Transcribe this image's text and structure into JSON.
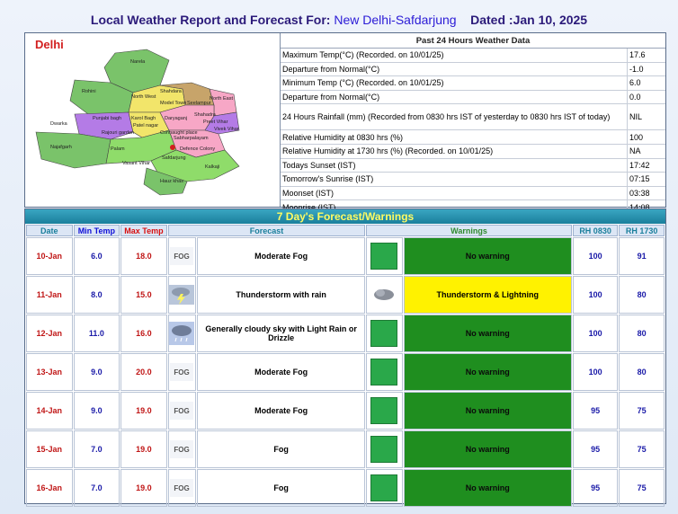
{
  "header": {
    "prefix": "Local Weather Report and Forecast For:",
    "station": "New Delhi-Safdarjung",
    "dated": "Dated :Jan 10, 2025"
  },
  "map": {
    "title": "Delhi",
    "labels": [
      "Narela",
      "Rohini",
      "North West",
      "Shahdara",
      "North East",
      "Model Town",
      "Seelampur",
      "Punjabi bagh",
      "Karol Bagh",
      "Daryaganj",
      "Dwarka",
      "Patel nagar",
      "Shahadra",
      "Preet Vihar",
      "Rajouri garden",
      "Connaught place",
      "Vivek Vihar",
      "Najafgarh",
      "Palam",
      "Sabharpalayam",
      "Defence Colony",
      "Safdarjung",
      "Vasant Vihar",
      "Kalkaji",
      "Hauz khas"
    ],
    "colors": {
      "outer": "#7ac36a",
      "west": "#b47be6",
      "central": "#f2e56a",
      "east": "#f7a7c6",
      "south": "#8fdc6a",
      "north": "#c7a46a"
    }
  },
  "past24": {
    "title": "Past 24 Hours Weather Data",
    "rows": [
      {
        "label": "Maximum Temp(°C) (Recorded. on 10/01/25)",
        "value": "17.6"
      },
      {
        "label": "Departure from Normal(°C)",
        "value": "-1.0"
      },
      {
        "label": "Minimum Temp (°C) (Recorded. on 10/01/25)",
        "value": "6.0"
      },
      {
        "label": "Departure from Normal(°C)",
        "value": "0.0"
      },
      {
        "label": "24 Hours Rainfall (mm) (Recorded from 0830 hrs IST of yesterday to 0830 hrs IST of today)",
        "value": "NIL"
      },
      {
        "label": "Relative Humidity at 0830 hrs (%)",
        "value": "100"
      },
      {
        "label": "Relative Humidity at 1730 hrs (%) (Recorded. on 10/01/25)",
        "value": "NA"
      },
      {
        "label": "Todays Sunset (IST)",
        "value": "17:42"
      },
      {
        "label": "Tomorrow's Sunrise (IST)",
        "value": "07:15"
      },
      {
        "label": "Moonset (IST)",
        "value": "03:38"
      },
      {
        "label": "Moonrise (IST)",
        "value": "14:08"
      }
    ]
  },
  "forecast": {
    "title": "7 Day's Forecast/Warnings",
    "headers": {
      "date": "Date",
      "min": "Min Temp",
      "max": "Max Temp",
      "forecast": "Forecast",
      "warnings": "Warnings",
      "rh0830": "RH 0830",
      "rh1730": "RH 1730"
    },
    "fog_text": "FOG",
    "rows": [
      {
        "date": "10-Jan",
        "min": "6.0",
        "max": "18.0",
        "icon": "fog-icon",
        "forecast": "Moderate Fog",
        "warning_icon": "green-square",
        "warning": "No warning",
        "warn_color": "#1f8e1f",
        "rh0830": "100",
        "rh1730": "91"
      },
      {
        "date": "11-Jan",
        "min": "8.0",
        "max": "15.0",
        "icon": "thunderstorm-icon",
        "forecast": "Thunderstorm with rain",
        "warning_icon": "storm-cloud-icon",
        "warning": "Thunderstorm & Lightning",
        "warn_color": "#fff200",
        "rh0830": "100",
        "rh1730": "80"
      },
      {
        "date": "12-Jan",
        "min": "11.0",
        "max": "16.0",
        "icon": "cloud-rain-icon",
        "forecast": "Generally cloudy sky with Light Rain or Drizzle",
        "warning_icon": "green-square",
        "warning": "No warning",
        "warn_color": "#1f8e1f",
        "rh0830": "100",
        "rh1730": "80"
      },
      {
        "date": "13-Jan",
        "min": "9.0",
        "max": "20.0",
        "icon": "fog-icon",
        "forecast": "Moderate Fog",
        "warning_icon": "green-square",
        "warning": "No warning",
        "warn_color": "#1f8e1f",
        "rh0830": "100",
        "rh1730": "80"
      },
      {
        "date": "14-Jan",
        "min": "9.0",
        "max": "19.0",
        "icon": "fog-icon",
        "forecast": "Moderate Fog",
        "warning_icon": "green-square",
        "warning": "No warning",
        "warn_color": "#1f8e1f",
        "rh0830": "95",
        "rh1730": "75"
      },
      {
        "date": "15-Jan",
        "min": "7.0",
        "max": "19.0",
        "icon": "fog-icon",
        "forecast": "Fog",
        "warning_icon": "green-square",
        "warning": "No warning",
        "warn_color": "#1f8e1f",
        "rh0830": "95",
        "rh1730": "75"
      },
      {
        "date": "16-Jan",
        "min": "7.0",
        "max": "19.0",
        "icon": "fog-icon",
        "forecast": "Fog",
        "warning_icon": "green-square",
        "warning": "No warning",
        "warn_color": "#1f8e1f",
        "rh0830": "95",
        "rh1730": "75"
      }
    ]
  }
}
